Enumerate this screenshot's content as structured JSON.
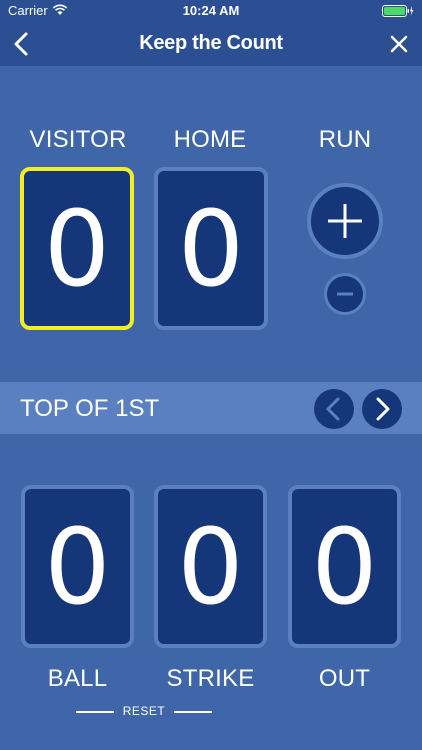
{
  "status": {
    "carrier": "Carrier",
    "time": "10:24 AM"
  },
  "nav": {
    "title": "Keep the Count"
  },
  "score": {
    "visitor": {
      "label": "VISITOR",
      "value": "0"
    },
    "home": {
      "label": "HOME",
      "value": "0"
    },
    "run_label": "RUN"
  },
  "inning": {
    "text": "TOP OF 1ST"
  },
  "count": {
    "ball": {
      "label": "BALL",
      "value": "0"
    },
    "strike": {
      "label": "STRIKE",
      "value": "0"
    },
    "out": {
      "label": "OUT",
      "value": "0"
    }
  },
  "reset_label": "RESET",
  "colors": {
    "background": "#3f66a8",
    "bar": "#2c4f93",
    "card": "#15377a",
    "card_border": "#5b80c2",
    "active_border": "#f3ee23"
  }
}
